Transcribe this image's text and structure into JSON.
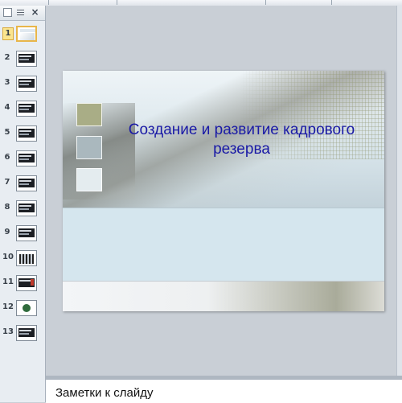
{
  "panel": {
    "close_symbol": "×",
    "icons": [
      "restore-icon",
      "outline-icon",
      "close-icon"
    ]
  },
  "slides": [
    {
      "num": "1",
      "active": true
    },
    {
      "num": "2"
    },
    {
      "num": "3"
    },
    {
      "num": "4"
    },
    {
      "num": "5"
    },
    {
      "num": "6"
    },
    {
      "num": "7"
    },
    {
      "num": "8"
    },
    {
      "num": "9"
    },
    {
      "num": "10"
    },
    {
      "num": "11"
    },
    {
      "num": "12"
    },
    {
      "num": "13"
    }
  ],
  "slide": {
    "title_line1": "Создание и развитие кадрового",
    "title_line2": "резерва",
    "title_color": "#1a1aa6"
  },
  "notes": {
    "placeholder": "Заметки к слайду"
  }
}
